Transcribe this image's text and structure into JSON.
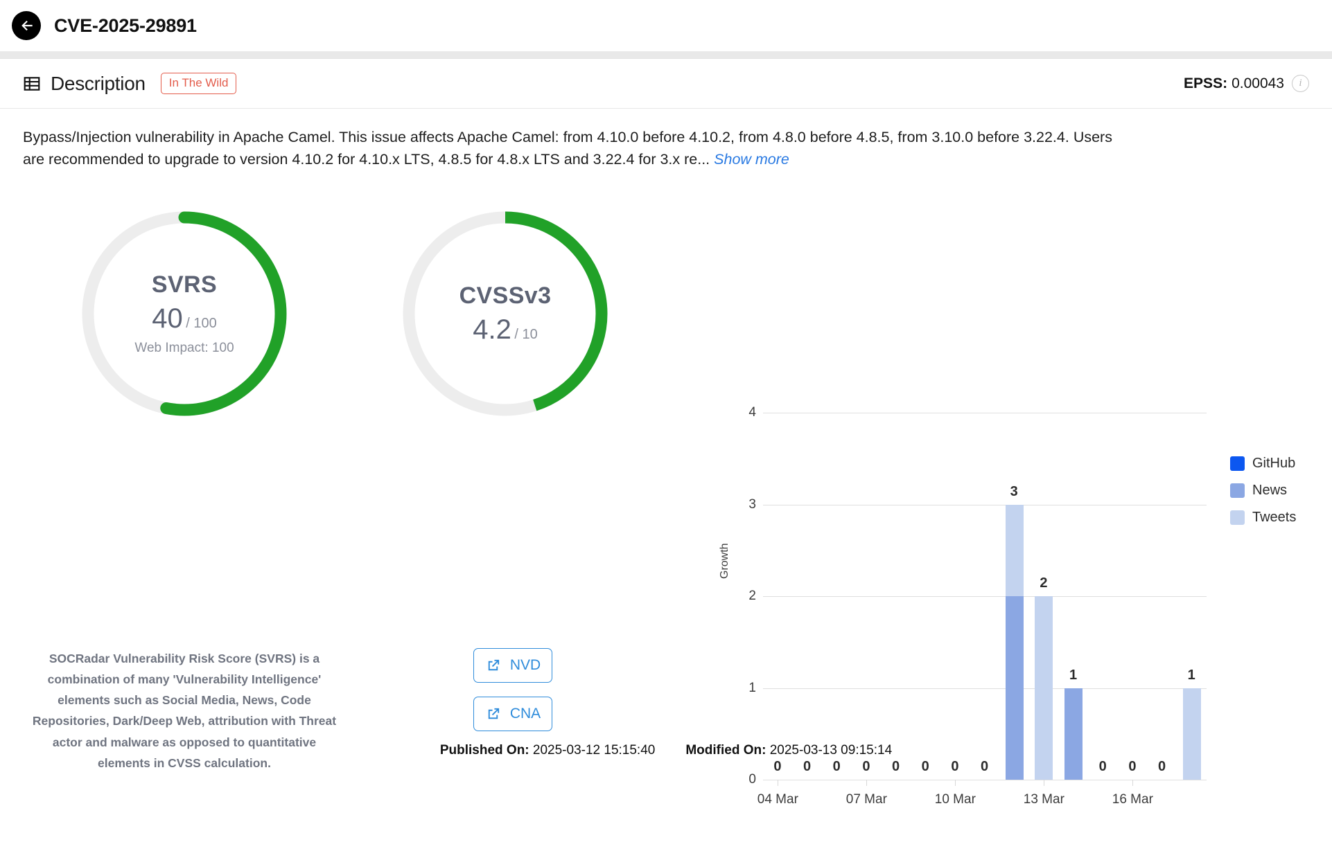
{
  "header": {
    "back_icon": "arrow-left-circle-icon",
    "title": "CVE-2025-29891"
  },
  "description_panel": {
    "icon": "table-list-icon",
    "title": "Description",
    "badge": "In The Wild",
    "epss_label": "EPSS:",
    "epss_value": "0.00043",
    "info_icon": "info-icon",
    "text": "Bypass/Injection vulnerability in Apache Camel. This issue affects Apache Camel: from 4.10.0 before 4.10.2, from 4.8.0 before 4.8.5, from 3.10.0 before 3.22.4. Users are recommended to upgrade to version 4.10.2 for 4.10.x LTS, 4.8.5 for 4.8.x LTS and 3.22.4 for 3.x re...",
    "show_more": "Show more"
  },
  "gauges": [
    {
      "name": "SVRS",
      "value": "40",
      "max": "/ 100",
      "sub": "Web Impact: 100",
      "percent": 53,
      "color": "#21a128",
      "track": "#ededed"
    },
    {
      "name": "CVSSv3",
      "value": "4.2",
      "max": "/ 10",
      "sub": "",
      "percent": 45,
      "color": "#21a128",
      "track": "#ededed"
    }
  ],
  "svrs_note": "SOCRadar Vulnerability Risk Score (SVRS) is a combination of many 'Vulnerability Intelligence' elements such as Social Media, News, Code Repositories, Dark/Deep Web, attribution with Threat actor and malware as opposed to quantitative elements in CVSS calculation.",
  "link_buttons": [
    {
      "label": "NVD",
      "icon": "external-link-icon"
    },
    {
      "label": "CNA",
      "icon": "external-link-icon"
    }
  ],
  "chart_data": {
    "type": "bar",
    "stacked": true,
    "title": "",
    "xlabel": "",
    "ylabel": "Growth",
    "ylim": [
      0,
      4
    ],
    "yticks": [
      "0",
      "1",
      "2",
      "3",
      "4"
    ],
    "grid": true,
    "legend_position": "right",
    "categories": [
      "04 Mar",
      "05 Mar",
      "06 Mar",
      "07 Mar",
      "08 Mar",
      "09 Mar",
      "10 Mar",
      "11 Mar",
      "12 Mar",
      "13 Mar",
      "14 Mar",
      "15 Mar",
      "16 Mar",
      "17 Mar",
      "18 Mar"
    ],
    "xtick_labels": [
      "04 Mar",
      "07 Mar",
      "10 Mar",
      "13 Mar",
      "16 Mar"
    ],
    "xtick_indices": [
      0,
      3,
      6,
      9,
      12
    ],
    "series": [
      {
        "name": "GitHub",
        "color": "#0c57f0",
        "values": [
          0,
          0,
          0,
          0,
          0,
          0,
          0,
          0,
          0,
          0,
          0,
          0,
          0,
          0,
          0
        ]
      },
      {
        "name": "News",
        "color": "#8ba7e3",
        "values": [
          0,
          0,
          0,
          0,
          0,
          0,
          0,
          0,
          2,
          0,
          1,
          0,
          0,
          0,
          0
        ]
      },
      {
        "name": "Tweets",
        "color": "#c3d3ef",
        "values": [
          0,
          0,
          0,
          0,
          0,
          0,
          0,
          0,
          1,
          2,
          0,
          0,
          0,
          0,
          1
        ]
      }
    ],
    "totals": [
      "0",
      "0",
      "0",
      "0",
      "0",
      "0",
      "0",
      "0",
      "3",
      "2",
      "1",
      "0",
      "0",
      "0",
      "1"
    ]
  },
  "footer": {
    "published_label": "Published On:",
    "published_value": "2025-03-12 15:15:40",
    "modified_label": "Modified On:",
    "modified_value": "2025-03-13 09:15:14"
  }
}
